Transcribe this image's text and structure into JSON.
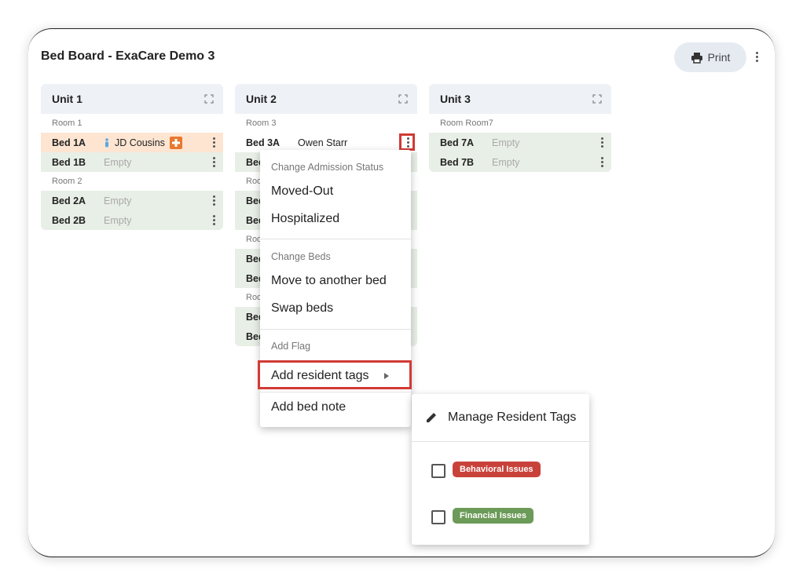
{
  "header": {
    "title": "Bed Board - ExaCare Demo 3",
    "print_label": "Print"
  },
  "units": [
    {
      "name": "Unit 1",
      "rooms": [
        {
          "label": "Room 1",
          "beds": [
            {
              "bed": "Bed 1A",
              "resident": "JD Cousins"
            },
            {
              "bed": "Bed 1B",
              "status": "Empty"
            }
          ]
        },
        {
          "label": "Room 2",
          "beds": [
            {
              "bed": "Bed 2A",
              "status": "Empty"
            },
            {
              "bed": "Bed 2B",
              "status": "Empty"
            }
          ]
        }
      ]
    },
    {
      "name": "Unit 2",
      "rooms": [
        {
          "label": "Room 3",
          "beds": [
            {
              "bed": "Bed 3A",
              "resident": "Owen Starr"
            },
            {
              "bed": "Bed"
            }
          ]
        },
        {
          "label": "Roo",
          "beds": [
            {
              "bed": "Bed"
            },
            {
              "bed": "Bed"
            }
          ]
        },
        {
          "label": "Roo",
          "beds": [
            {
              "bed": "Bed"
            },
            {
              "bed": "Bed"
            }
          ]
        },
        {
          "label": "Roo",
          "beds": [
            {
              "bed": "Bed"
            },
            {
              "bed": "Bed"
            }
          ]
        }
      ]
    },
    {
      "name": "Unit 3",
      "rooms": [
        {
          "label": "Room Room7",
          "beds": [
            {
              "bed": "Bed 7A",
              "status": "Empty"
            },
            {
              "bed": "Bed 7B",
              "status": "Empty"
            }
          ]
        }
      ]
    }
  ],
  "context_menu": {
    "section_admission": "Change Admission Status",
    "moved_out": "Moved-Out",
    "hospitalized": "Hospitalized",
    "section_beds": "Change Beds",
    "move_bed": "Move to another bed",
    "swap_beds": "Swap beds",
    "section_flag": "Add Flag",
    "add_tags": "Add resident tags",
    "add_note": "Add bed note"
  },
  "tags_menu": {
    "manage": "Manage Resident Tags",
    "tags": [
      {
        "label": "Behavioral Issues",
        "color": "#c9423a"
      },
      {
        "label": "Financial Issues",
        "color": "#6c9a58"
      }
    ]
  },
  "colors": {
    "highlight": "#d23a35",
    "occupied_peach": "#fde5d2",
    "empty_green": "#e8efe6",
    "hospital_icon": "#e8782f",
    "person_icon": "#5aa8e0"
  }
}
